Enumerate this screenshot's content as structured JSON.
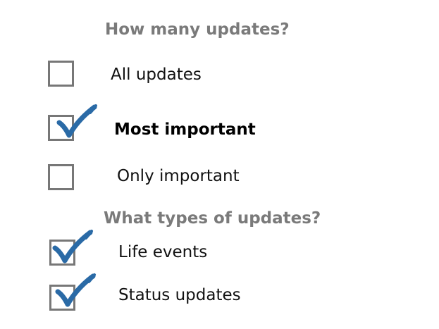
{
  "colors": {
    "heading": "#7a7a7a",
    "checkbox_border": "#777777",
    "checkmark": "#2a6aa6",
    "text": "#111111"
  },
  "section_frequency": {
    "heading": "How many updates?",
    "options": [
      {
        "label": "All updates",
        "checked": false,
        "emphasized": false
      },
      {
        "label": "Most important",
        "checked": true,
        "emphasized": true
      },
      {
        "label": "Only important",
        "checked": false,
        "emphasized": false
      }
    ]
  },
  "section_types": {
    "heading": "What types of updates?",
    "options": [
      {
        "label": "Life events",
        "checked": true,
        "emphasized": false
      },
      {
        "label": "Status updates",
        "checked": true,
        "emphasized": false
      }
    ]
  }
}
